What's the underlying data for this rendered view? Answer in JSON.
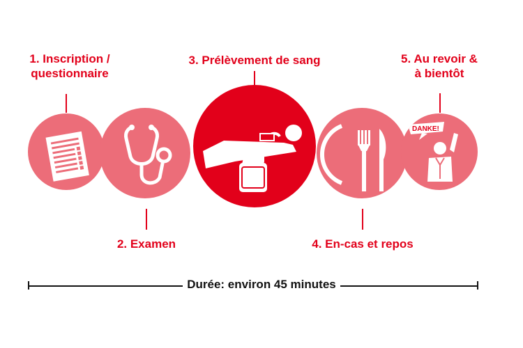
{
  "steps": [
    {
      "line1": "1. Inscription /",
      "line2": "questionnaire"
    },
    {
      "line1": "2. Examen"
    },
    {
      "line1": "3. Prélèvement de sang"
    },
    {
      "line1": "4. En-cas et repos"
    },
    {
      "line1": "5. Au revoir &",
      "line2": "à bientôt"
    }
  ],
  "badge_text": "DANKE!",
  "duration": "Durée: environ 45 minutes",
  "colors": {
    "accent": "#e2001a",
    "pale": "#ec6d79",
    "text": "#111111"
  },
  "icons": [
    "form-icon",
    "stethoscope-icon",
    "blood-donation-icon",
    "plate-cutlery-icon",
    "thank-you-person-icon"
  ]
}
